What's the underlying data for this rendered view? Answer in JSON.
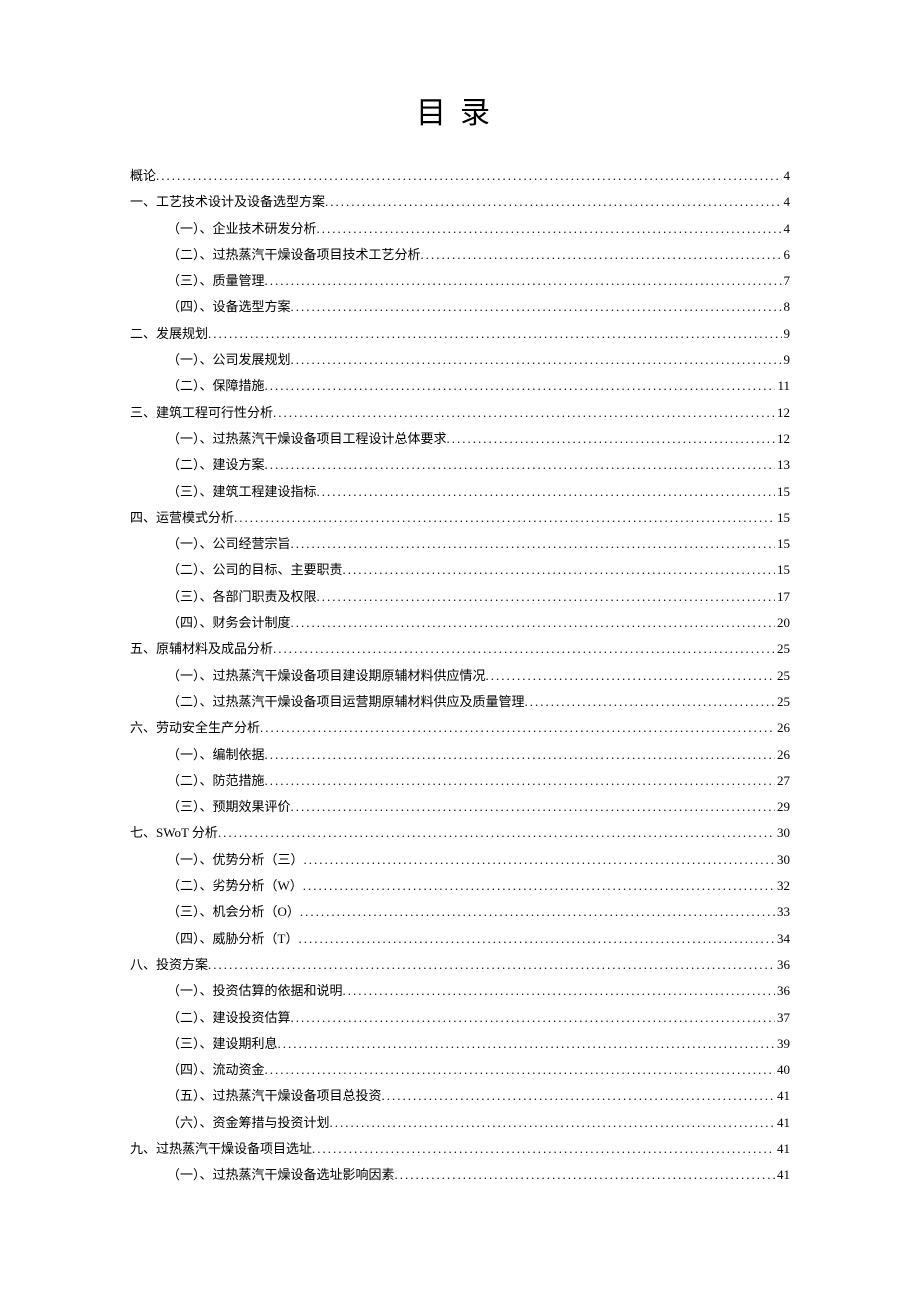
{
  "title": "目录",
  "toc": [
    {
      "level": 0,
      "label": "概论",
      "page": "4"
    },
    {
      "level": 0,
      "label": "一、工艺技术设计及设备选型方案",
      "page": "4"
    },
    {
      "level": 1,
      "label": "（一）、企业技术研发分析",
      "page": "4"
    },
    {
      "level": 1,
      "label": "（二）、过热蒸汽干燥设备项目技术工艺分析",
      "page": "6"
    },
    {
      "level": 1,
      "label": "（三）、质量管理",
      "page": "7"
    },
    {
      "level": 1,
      "label": "（四）、设备选型方案",
      "page": "8"
    },
    {
      "level": 0,
      "label": "二、发展规划",
      "page": "9"
    },
    {
      "level": 1,
      "label": "（一）、公司发展规划",
      "page": "9"
    },
    {
      "level": 1,
      "label": "（二）、保障措施",
      "page": "11"
    },
    {
      "level": 0,
      "label": "三、建筑工程可行性分析",
      "page": "12"
    },
    {
      "level": 1,
      "label": "（一）、过热蒸汽干燥设备项目工程设计总体要求",
      "page": "12"
    },
    {
      "level": 1,
      "label": "（二）、建设方案",
      "page": "13"
    },
    {
      "level": 1,
      "label": "（三）、建筑工程建设指标",
      "page": "15"
    },
    {
      "level": 0,
      "label": "四、运营模式分析",
      "page": "15"
    },
    {
      "level": 1,
      "label": "（一）、公司经营宗旨",
      "page": "15"
    },
    {
      "level": 1,
      "label": "（二）、公司的目标、主要职责",
      "page": "15"
    },
    {
      "level": 1,
      "label": "（三）、各部门职责及权限",
      "page": "17"
    },
    {
      "level": 1,
      "label": "（四）、财务会计制度",
      "page": "20"
    },
    {
      "level": 0,
      "label": "五、原辅材料及成品分析",
      "page": "25"
    },
    {
      "level": 1,
      "label": "（一）、过热蒸汽干燥设备项目建设期原辅材料供应情况",
      "page": "25"
    },
    {
      "level": 1,
      "label": "（二）、过热蒸汽干燥设备项目运营期原辅材料供应及质量管理",
      "page": "25"
    },
    {
      "level": 0,
      "label": "六、劳动安全生产分析",
      "page": "26"
    },
    {
      "level": 1,
      "label": "（一）、编制依据",
      "page": "26"
    },
    {
      "level": 1,
      "label": "（二）、防范措施",
      "page": "27"
    },
    {
      "level": 1,
      "label": "（三）、预期效果评价",
      "page": "29"
    },
    {
      "level": 0,
      "label": "七、SWoT 分析",
      "page": "30"
    },
    {
      "level": 1,
      "label": "（一）、优势分析（三）",
      "page": "30"
    },
    {
      "level": 1,
      "label": "（二）、劣势分析（W）",
      "page": "32"
    },
    {
      "level": 1,
      "label": "（三）、机会分析（O）",
      "page": "33"
    },
    {
      "level": 1,
      "label": "（四）、威胁分析（T）",
      "page": "34"
    },
    {
      "level": 0,
      "label": "八、投资方案",
      "page": "36"
    },
    {
      "level": 1,
      "label": "（一）、投资估算的依据和说明",
      "page": "36"
    },
    {
      "level": 1,
      "label": "（二）、建设投资估算",
      "page": "37"
    },
    {
      "level": 1,
      "label": "（三）、建设期利息",
      "page": "39"
    },
    {
      "level": 1,
      "label": "（四）、流动资金",
      "page": "40"
    },
    {
      "level": 1,
      "label": "（五）、过热蒸汽干燥设备项目总投资",
      "page": "41"
    },
    {
      "level": 1,
      "label": "（六）、资金筹措与投资计划",
      "page": "41"
    },
    {
      "level": 0,
      "label": "九、过热蒸汽干燥设备项目选址",
      "page": "41"
    },
    {
      "level": 1,
      "label": "（一）、过热蒸汽干燥设备选址影响因素",
      "page": "41"
    }
  ]
}
